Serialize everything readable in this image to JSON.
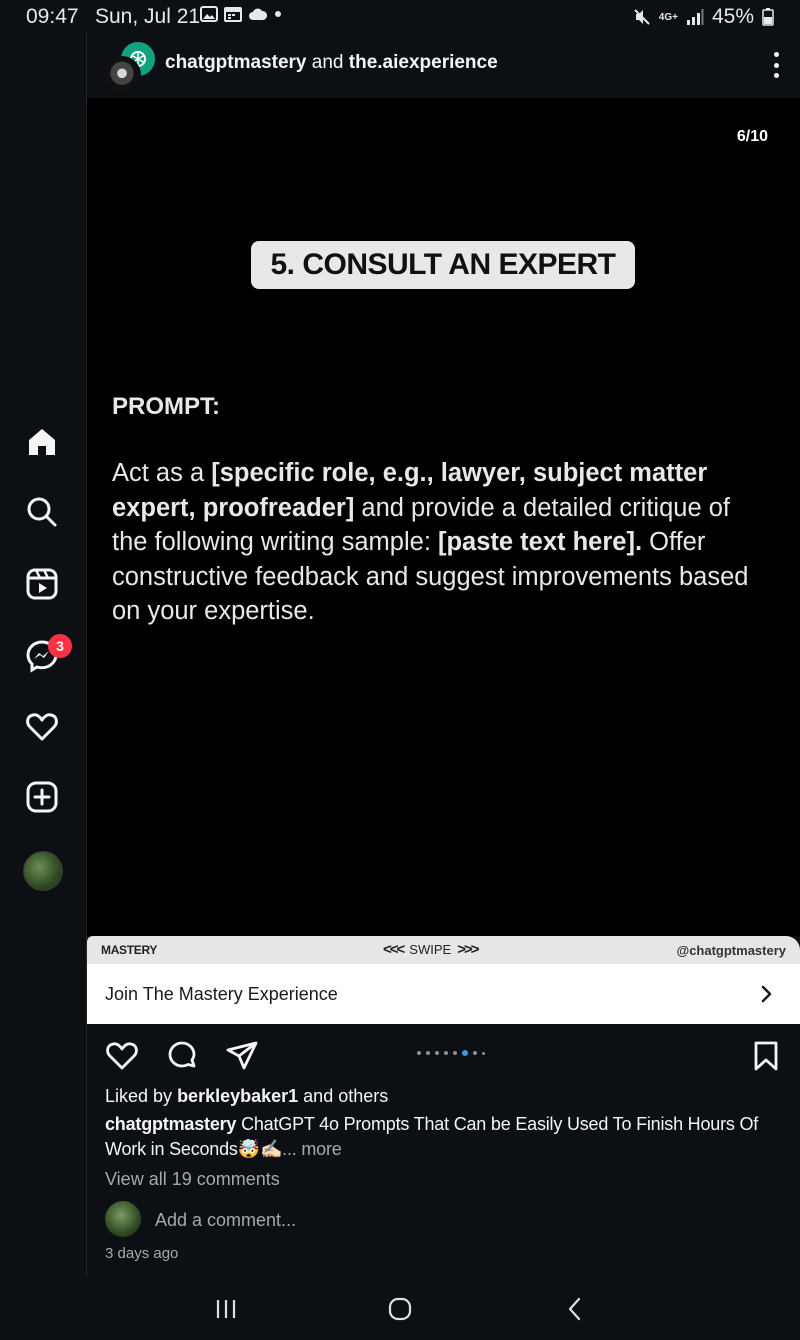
{
  "status_bar": {
    "time": "09:47",
    "date": "Sun, Jul 21",
    "battery": "45%",
    "network": "4G+"
  },
  "sidebar": {
    "items": [
      {
        "name": "home-icon"
      },
      {
        "name": "search-icon"
      },
      {
        "name": "reels-icon"
      },
      {
        "name": "messenger-icon",
        "badge": "3"
      },
      {
        "name": "heart-icon"
      },
      {
        "name": "create-icon"
      },
      {
        "name": "profile-avatar"
      }
    ]
  },
  "post": {
    "author_primary": "chatgptmastery",
    "connector": "and",
    "author_secondary": "the.aiexperience",
    "page_counter": "6/10",
    "slide_title": "5. CONSULT AN EXPERT",
    "prompt_label": "PROMPT:",
    "prompt_parts": {
      "p1": "Act as a ",
      "b1": "[specific role, e.g., lawyer, subject matter expert, proofreader]",
      "p2": " and provide a detailed critique of the following writing sample: ",
      "b2": "[paste text here].",
      "p3": " Offer constructive feedback and suggest improvements based on your expertise."
    },
    "footer_left": "MASTERY",
    "footer_swipe": "SWIPE",
    "footer_handle": "@chatgptmastery",
    "cta_label": "Join The Mastery Experience",
    "carousel": {
      "total": 10,
      "current": 6
    },
    "liked_by_prefix": "Liked by",
    "liked_by_user": "berkleybaker1",
    "liked_by_suffix": "and others",
    "caption_user": "chatgptmastery",
    "caption_text": "ChatGPT 4o Prompts That Can be Easily Used To Finish Hours Of Work in Seconds🤯✍🏻",
    "caption_more": "... more",
    "view_comments": "View all 19 comments",
    "add_comment_placeholder": "Add a comment...",
    "timestamp": "3 days ago"
  },
  "colors": {
    "background": "#0c1014",
    "badge": "#ff3040",
    "accent_dot": "#3897f0",
    "slide_bg": "#000000",
    "pill_bg": "#e8e8e8"
  }
}
